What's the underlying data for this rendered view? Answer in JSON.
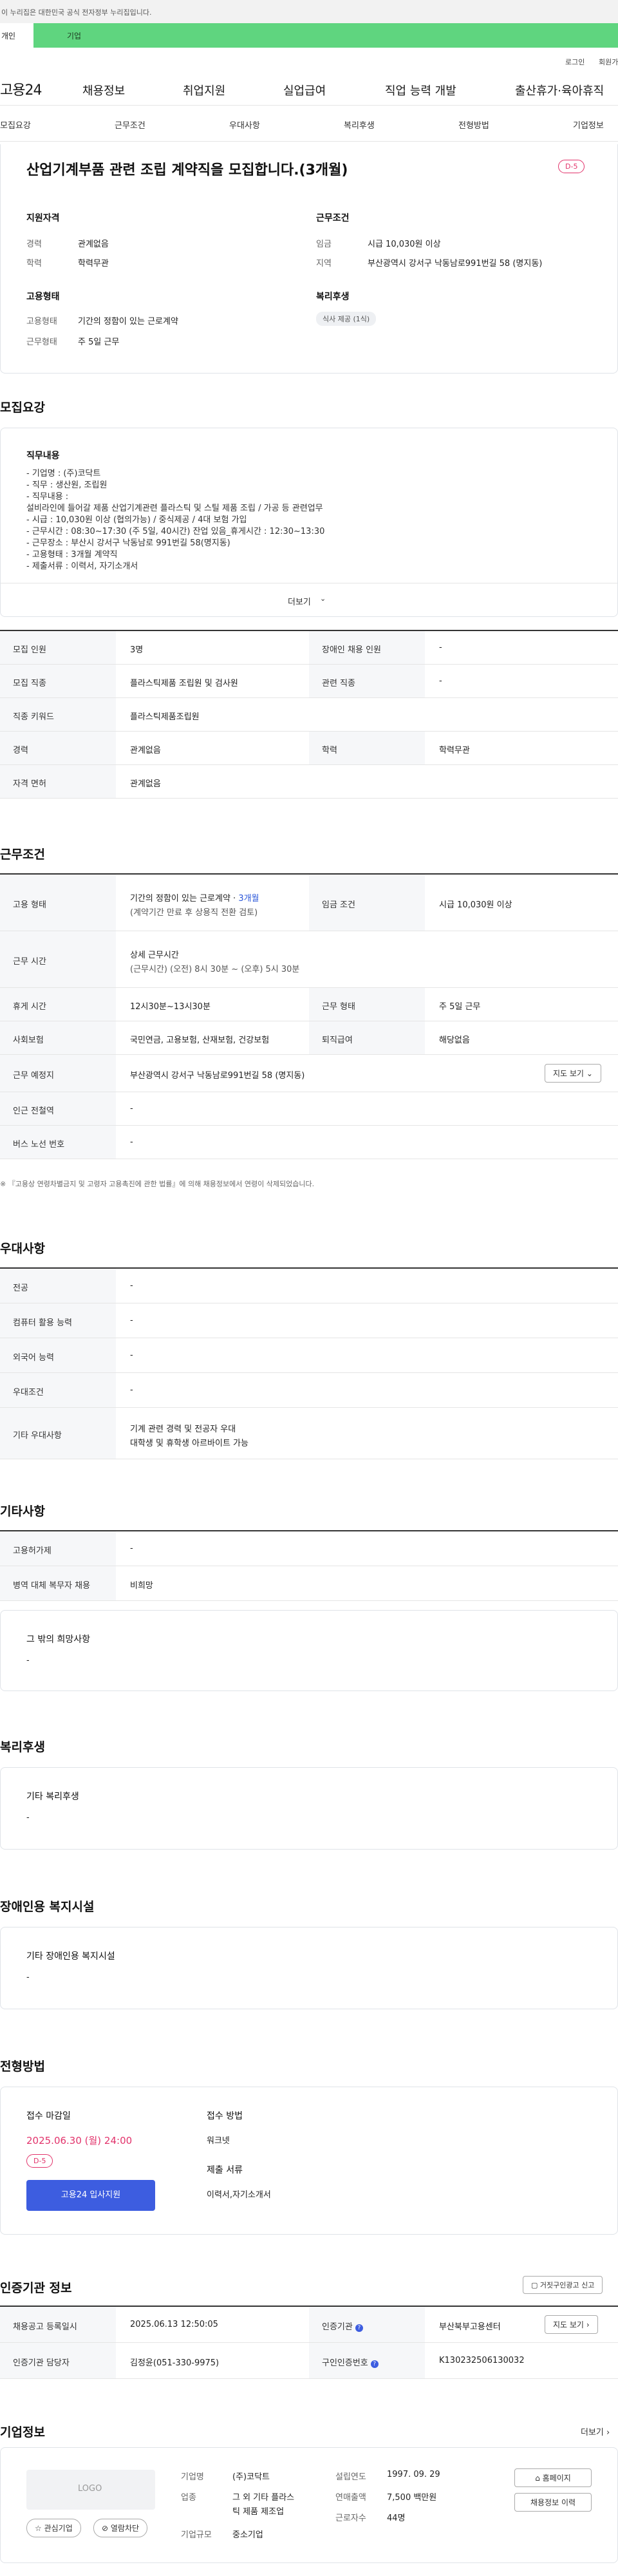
{
  "gov_banner": "이 누리집은 대한민국 공식 전자정부 누리집입니다.",
  "tabs": {
    "active": "개인",
    "other": "기업"
  },
  "utility": {
    "login": "로그인",
    "join": "회원가입"
  },
  "gnb": {
    "logo": "고용24",
    "menus": [
      "채용정보",
      "취업지원",
      "실업급여",
      "직업 능력 개발",
      "출산휴가·육아휴직"
    ]
  },
  "subnav": [
    "모집요강",
    "근무조건",
    "우대사항",
    "복리후생",
    "전형방법",
    "기업정보"
  ],
  "summary": {
    "title": "산업기계부품 관련 조립 계약직을 모집합니다.(3개월)",
    "dday": "D-5",
    "qual_label": "지원자격",
    "qual": [
      {
        "k": "경력",
        "v": "관계없음"
      },
      {
        "k": "학력",
        "v": "학력무관"
      }
    ],
    "cond_label": "근무조건",
    "cond": [
      {
        "k": "임금",
        "v": "시급 10,030원 이상"
      },
      {
        "k": "지역",
        "v": "부산광역시 강서구 낙동남로991번길 58 (명지동)"
      }
    ],
    "emp_label": "고용형태",
    "emp": [
      {
        "k": "고용형태",
        "v": "기간의 정함이 있는 근로계약"
      },
      {
        "k": "근무형태",
        "v": "주 5일 근무"
      }
    ],
    "welfare_label": "복리후생",
    "welfare_pill": "식사 제공 (1식)"
  },
  "recruit": {
    "heading": "모집요강",
    "duty_label": "직무내용",
    "duty_lines": [
      "- 기업명 : (주)코닥트",
      "- 직무 : 생산원, 조립원",
      "- 직무내용 :",
      "설비라인에 들어갈 제품 산업기계관련 플라스틱 및 스틸 제품 조립 / 가공 등 관련업무",
      "- 시급 : 10,030원 이상 (협의가능) / 중식제공 / 4대 보험 가입",
      "- 근무시간 : 08:30~17:30 (주 5일, 40시간) 잔업 있음_휴게시간 : 12:30~13:30",
      "- 근무장소 : 부산시 강서구 낙동남로 991번길 58(명지동)",
      "- 고용형태 : 3개월 계약직",
      "- 제출서류 : 이력서, 자기소개서"
    ],
    "more": "더보기",
    "table": [
      {
        "k1": "모집 인원",
        "v1": "3명",
        "k2": "장애인 채용 인원",
        "v2": "-"
      },
      {
        "k1": "모집 직종",
        "v1": "플라스틱제품 조립원 및 검사원",
        "k2": "관련 직종",
        "v2": "-"
      },
      {
        "k1": "직종 키워드",
        "v1": "플라스틱제품조립원"
      },
      {
        "k1": "경력",
        "v1": "관계없음",
        "k2": "학력",
        "v2": "학력무관"
      },
      {
        "k1": "자격 면허",
        "v1": "관계없음"
      }
    ]
  },
  "work": {
    "heading": "근무조건",
    "emp_k": "고용 형태",
    "emp_v1": "기간의 정함이 있는 근로계약 · ",
    "emp_v1_blue": "3개월",
    "emp_v2": "(계약기간 만료 후 상용직 전환 검토)",
    "wage_k": "임금 조건",
    "wage_v": "시급 10,030원 이상",
    "time_k": "근무 시간",
    "time_v1": "상세 근무시간",
    "time_v2": "(근무시간) (오전) 8시 30분 ~ (오후) 5시 30분",
    "rest_k": "휴게 시간",
    "rest_v": "12시30분~13시30분",
    "shape_k": "근무 형태",
    "shape_v": "주 5일 근무",
    "ins_k": "사회보험",
    "ins_v": "국민연금, 고용보험, 산재보험, 건강보험",
    "ret_k": "퇴직급여",
    "ret_v": "해당없음",
    "place_k": "근무 예정지",
    "place_v": "부산광역시 강서구 낙동남로991번길 58 (명지동)",
    "map_btn": "지도 보기",
    "subway_k": "인근 전철역",
    "subway_v": "-",
    "bus_k": "버스 노선 번호",
    "bus_v": "-",
    "note": "※ 『고용상 연령차별금지 및 고령자 고용촉진에 관한 법률』에 의해 채용정보에서 연령이 삭제되었습니다."
  },
  "pref": {
    "heading": "우대사항",
    "rows": [
      {
        "k": "전공",
        "v": "-"
      },
      {
        "k": "컴퓨터 활용 능력",
        "v": "-"
      },
      {
        "k": "외국어 능력",
        "v": "-"
      },
      {
        "k": "우대조건",
        "v": "-"
      }
    ],
    "etc_k": "기타 우대사항",
    "etc_v1": "기계 관련 경력 및 전공자 우대",
    "etc_v2": "대학생 및 휴학생 아르바이트 가능"
  },
  "others": {
    "heading": "기타사항",
    "rows": [
      {
        "k": "고용허가제",
        "v": "-"
      },
      {
        "k": "병역 대체 복무자 채용",
        "v": "비희망"
      }
    ],
    "hope_label": "그 밖의 희망사항",
    "hope_v": "-"
  },
  "welfare": {
    "heading": "복리후생",
    "label": "기타 복리후생",
    "v": "-"
  },
  "disability": {
    "heading": "장애인용 복지시설",
    "label": "기타 장애인용 복지시설",
    "v": "-"
  },
  "process": {
    "heading": "전형방법",
    "deadline_label": "접수 마감일",
    "deadline": "2025.06.30 (월) 24:00",
    "dday": "D-5",
    "apply_btn": "고용24 입사지원",
    "method_label": "접수 방법",
    "method_v": "워크넷",
    "docs_label": "제출 서류",
    "docs_v": "이력서,자기소개서"
  },
  "auth": {
    "heading": "인증기관 정보",
    "report_btn": "거짓구인광고 신고",
    "reg_k": "채용공고 등록일시",
    "reg_v": "2025.06.13 12:50:05",
    "org_k": "인증기관",
    "org_v": "부산북부고용센터",
    "map_btn": "지도 보기",
    "manager_k": "인증기관 담당자",
    "manager_v": "김정윤(051-330-9975)",
    "certno_k": "구인인증번호",
    "certno_v": "K130232506130032"
  },
  "company": {
    "heading": "기업정보",
    "more": "더보기",
    "logo": "LOGO",
    "fav_btn": "관심기업",
    "block_btn": "열람차단",
    "name_k": "기업명",
    "name_v": "(주)코닥트",
    "ind_k": "업종",
    "ind_v1": "그 외 기타 플라스",
    "ind_v2": "틱 제품 제조업",
    "size_k": "기업규모",
    "size_v": "중소기업",
    "est_k": "설립연도",
    "est_v": "1997. 09. 29",
    "sales_k": "연매출액",
    "sales_v": "7,500 백만원",
    "staff_k": "근로자수",
    "staff_v": "44명",
    "home_btn": "홈페이지",
    "other_btn": "채용정보 이력"
  },
  "colors": {
    "accent_green": "#5fd57f",
    "brand_blue": "#3d5de0",
    "dday_red": "#e2336b"
  }
}
